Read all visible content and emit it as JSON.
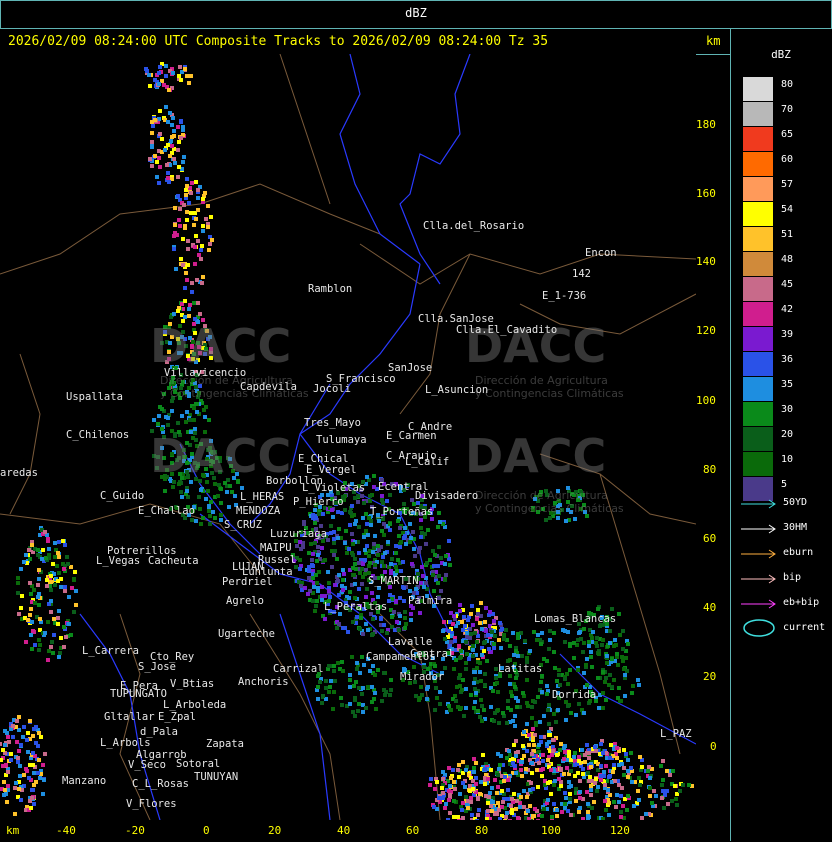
{
  "header": {
    "top_label": "dBZ",
    "title": "2026/02/09 08:24:00 UTC Composite Tracks to 2026/02/09 08:24:00 Tz 35",
    "km_top": "km",
    "km_bottom": "km"
  },
  "axes": {
    "x_ticks": [
      "-40",
      "-20",
      "0",
      "20",
      "40",
      "60",
      "80",
      "100",
      "120"
    ],
    "y_ticks": [
      "180",
      "160",
      "140",
      "120",
      "100",
      "80",
      "60",
      "40",
      "20",
      "0"
    ]
  },
  "legend": {
    "title": "dBZ",
    "scale": [
      {
        "value": "80",
        "color": "#d9d9d9"
      },
      {
        "value": "70",
        "color": "#b8b8b8"
      },
      {
        "value": "65",
        "color": "#f03a1e"
      },
      {
        "value": "60",
        "color": "#ff6a00"
      },
      {
        "value": "57",
        "color": "#ff9a5a"
      },
      {
        "value": "54",
        "color": "#ffff00"
      },
      {
        "value": "51",
        "color": "#ffc22a"
      },
      {
        "value": "48",
        "color": "#d08a3a"
      },
      {
        "value": "45",
        "color": "#c86a8a"
      },
      {
        "value": "42",
        "color": "#d01e8e"
      },
      {
        "value": "39",
        "color": "#7a1ad0"
      },
      {
        "value": "36",
        "color": "#2a52e8"
      },
      {
        "value": "35",
        "color": "#1e8ee0"
      },
      {
        "value": "30",
        "color": "#0a8a1a"
      },
      {
        "value": "20",
        "color": "#0a5e1a"
      },
      {
        "value": "10",
        "color": "#0a6a0a"
      },
      {
        "value": "5",
        "color": "#4a3a8a"
      }
    ],
    "tracks": [
      {
        "label": "50YD",
        "color": "#40e0e0"
      },
      {
        "label": "30HM",
        "color": "#ffffff"
      },
      {
        "label": "eburn",
        "color": "#ffb040"
      },
      {
        "label": "bip",
        "color": "#ffc0c0"
      },
      {
        "label": "eb+bip",
        "color": "#ff40ff"
      }
    ],
    "current_label": "current",
    "current_color": "#40e0e0"
  },
  "watermark": {
    "text": "DACC",
    "subtitle_1": "Dirección de Agricultura",
    "subtitle_2": "y Contingencias Climáticas"
  },
  "places": [
    "Clla.del_Rosario",
    "Encon",
    "142",
    "E_1-736",
    "Ramblon",
    "Clla.SanJose",
    "Clla.El_Cavadito",
    "Villavicencio",
    "Capdevila",
    "S_Francisco",
    "SanJose",
    "L_Asuncion",
    "Uspallata",
    "Jocoli",
    "Tres_Mayo",
    "Tulumaya",
    "E_Carmen",
    "C_Andre",
    "C_Chilenos",
    "E_Chical",
    "C_Araujo",
    "L_Calif",
    "E_Vergel",
    "Borbollon",
    "L_Violetas",
    "Ecentral",
    "Divisadero",
    "aredas",
    "C_Guido",
    "L_HERAS",
    "P_Hierro",
    "T_Porteñas",
    "E_Challao",
    "MENDOZA",
    "S_CRUZ",
    "Luzuriaga",
    "Potrerillos",
    "L_Vegas",
    "Cacheuta",
    "MAIPU",
    "Russel",
    "LUJAN",
    "Lunlunta",
    "Perdriel",
    "S_MARTIN",
    "Agrelo",
    "Palmira",
    "L_Peraltas",
    "Lomas_Blancas",
    "Ugarteche",
    "L_Carrera",
    "Cto_Rey",
    "S_Jose",
    "Carrizal",
    "Campamentos",
    "Central",
    "Lavalle",
    "E_Pera",
    "V_Btias",
    "Anchoris",
    "TUPUNGATO",
    "Mirador",
    "Latitas",
    "L_Arboleda",
    "Dorrida",
    "Gltallar",
    "E_Zpal",
    "L_Arbols",
    "d_Pala",
    "Zapata",
    "L_PAZ",
    "Algarrob",
    "V_Seco",
    "Sotoral",
    "TUNUYAN",
    "Manzano",
    "C_L_Rosas",
    "V_Flores"
  ]
}
